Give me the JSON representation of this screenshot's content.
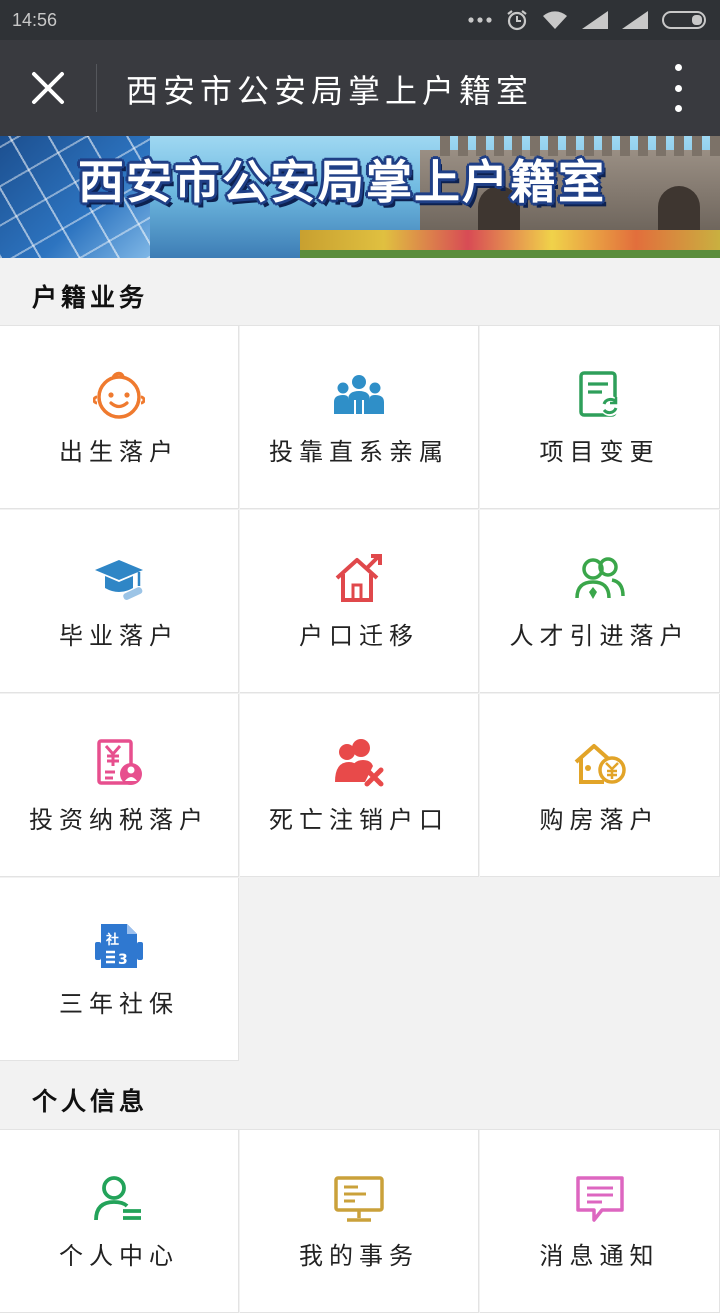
{
  "status_bar": {
    "time": "14:56",
    "icons": [
      "more-dots-icon",
      "alarm-icon",
      "wifi-icon",
      "signal-icon",
      "signal-icon",
      "battery-icon"
    ]
  },
  "header": {
    "title": "西安市公安局掌上户籍室",
    "close_icon": "close-icon",
    "menu_icon": "more-vertical-icon"
  },
  "banner": {
    "title": "西安市公安局掌上户籍室"
  },
  "sections": [
    {
      "title": "户籍业务",
      "items": [
        {
          "label": "出生落户",
          "icon": "baby-face-icon",
          "color": "#ef7a2f"
        },
        {
          "label": "投靠直系亲属",
          "icon": "family-group-icon",
          "color": "#2f8fc8"
        },
        {
          "label": "项目变更",
          "icon": "document-refresh-icon",
          "color": "#2e9f5a"
        },
        {
          "label": "毕业落户",
          "icon": "graduation-cap-icon",
          "color": "#2f86c6"
        },
        {
          "label": "户口迁移",
          "icon": "house-arrow-icon",
          "color": "#e0484b"
        },
        {
          "label": "人才引进落户",
          "icon": "people-diamond-icon",
          "color": "#3aa64a"
        },
        {
          "label": "投资纳税落户",
          "icon": "yen-certificate-icon",
          "color": "#e74f8e"
        },
        {
          "label": "死亡注销户口",
          "icon": "person-cancel-icon",
          "color": "#e84a4a"
        },
        {
          "label": "购房落户",
          "icon": "house-yen-icon",
          "color": "#e2a428"
        },
        {
          "label": "三年社保",
          "icon": "social-insurance-icon",
          "color": "#2f78d0"
        }
      ]
    },
    {
      "title": "个人信息",
      "items": [
        {
          "label": "个人中心",
          "icon": "user-list-icon",
          "color": "#23a35a"
        },
        {
          "label": "我的事务",
          "icon": "monitor-icon",
          "color": "#caa13a"
        },
        {
          "label": "消息通知",
          "icon": "message-icon",
          "color": "#dd66c0"
        }
      ]
    }
  ]
}
